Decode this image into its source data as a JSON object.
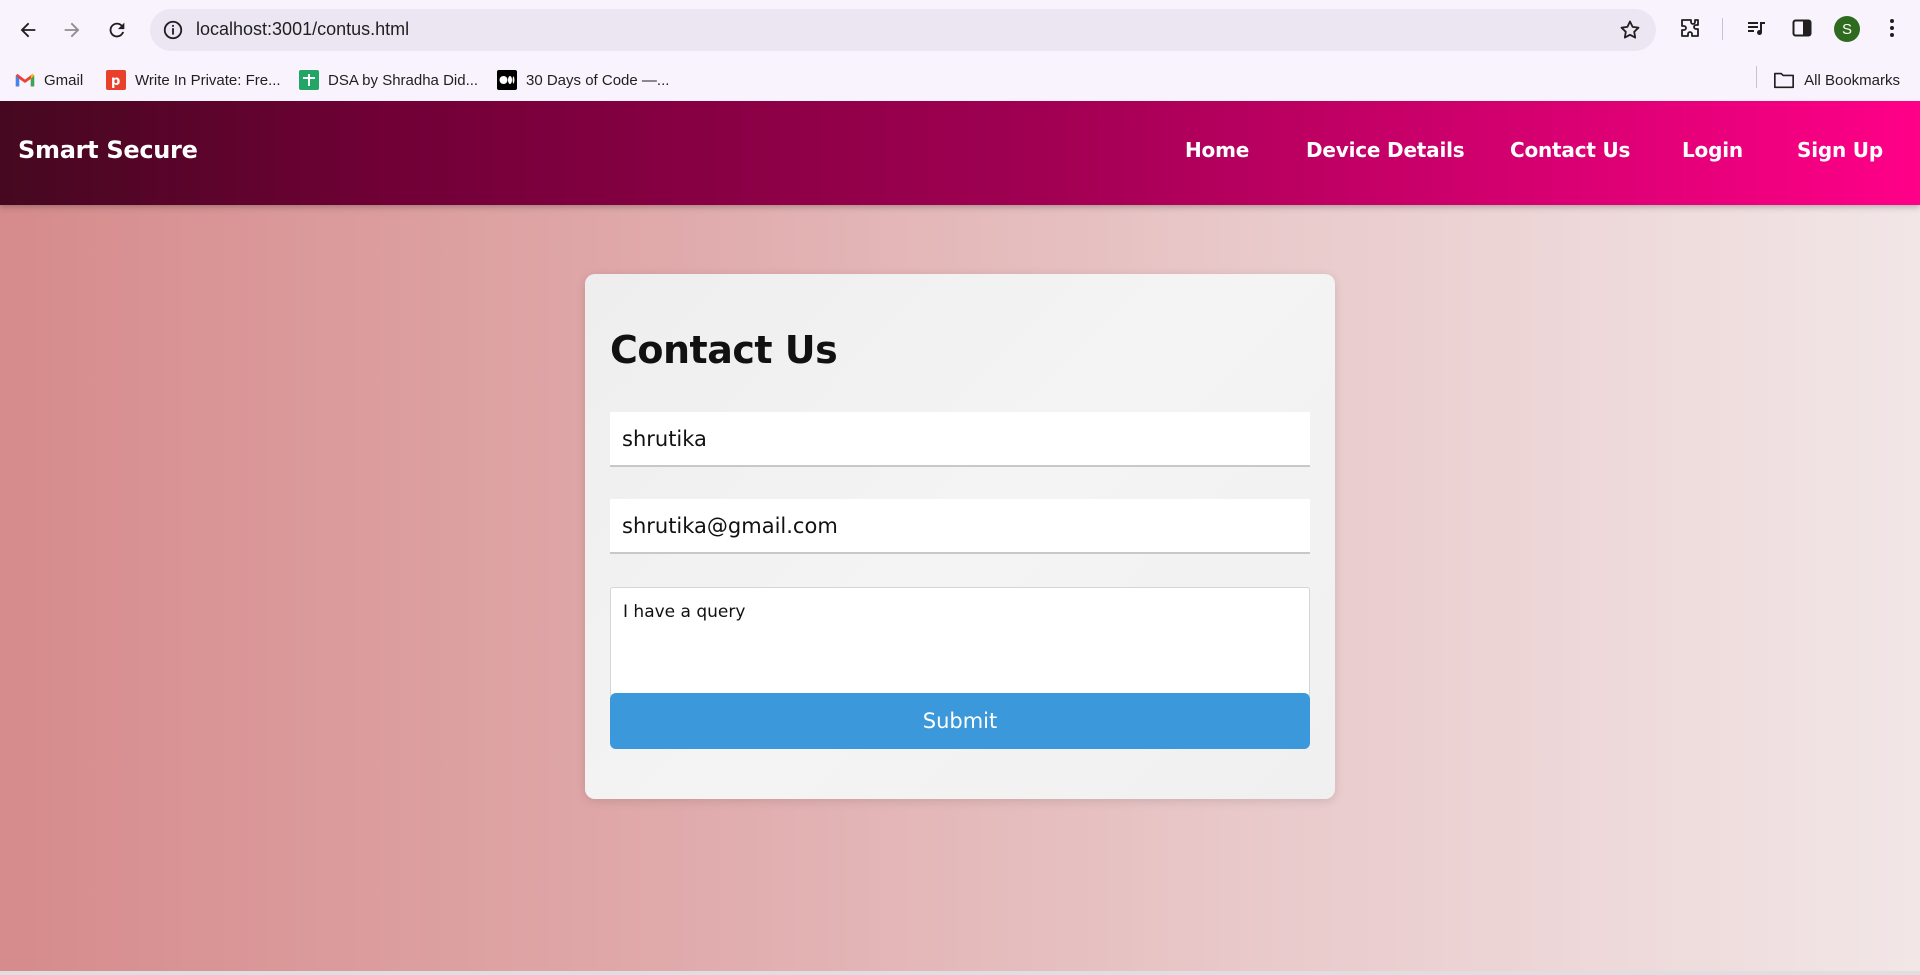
{
  "browser": {
    "url": "localhost:3001/contus.html",
    "avatar_letter": "S",
    "bookmarks": [
      {
        "label": "Gmail",
        "icon": "gmail-icon"
      },
      {
        "label": "Write In Private: Fre...",
        "icon": "write-in-private-icon"
      },
      {
        "label": "DSA by Shradha Did...",
        "icon": "sheets-icon"
      },
      {
        "label": "30 Days of Code —...",
        "icon": "medium-icon"
      }
    ],
    "all_bookmarks_label": "All Bookmarks"
  },
  "navbar": {
    "brand": "Smart Secure",
    "links": [
      "Home",
      "Device Details",
      "Contact Us",
      "Login",
      "Sign Up"
    ]
  },
  "contact_form": {
    "title": "Contact Us",
    "name_value": "shrutika",
    "email_value": "shrutika@gmail.com",
    "message_value": "I have a query",
    "submit_label": "Submit"
  },
  "colors": {
    "navbar_start": "#45081f",
    "navbar_end": "#ff0088",
    "submit_button": "#3a98db",
    "avatar": "#2e6b1e"
  }
}
